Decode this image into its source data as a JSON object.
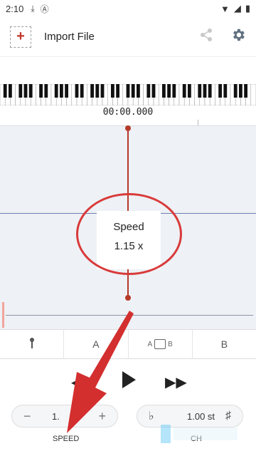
{
  "status_bar": {
    "time": "2:10",
    "icons": [
      "download-icon",
      "text-a-icon"
    ],
    "right_icons": [
      "wifi-icon",
      "signal-icon",
      "battery-icon"
    ]
  },
  "app_bar": {
    "add_symbol": "+",
    "title": "Import File",
    "share_icon": "share-icon",
    "settings_icon": "gear-icon"
  },
  "timeline": {
    "timecode": "00:00.000"
  },
  "speed_popup": {
    "label": "Speed",
    "value": "1.15 x"
  },
  "ab_bar": {
    "a_label": "A",
    "b_label": "B",
    "loop_a": "A",
    "loop_b": "B"
  },
  "controls": {
    "speed": {
      "value": "1.",
      "label": "SPEED",
      "minus": "−",
      "plus": "+"
    },
    "pitch": {
      "value": "1.00 st",
      "label": "CH",
      "flat": "♭",
      "sharp": "♯"
    }
  },
  "colors": {
    "accent": "#b53a2c",
    "annotation": "#d93a3a",
    "wave_bg": "#eef1f5"
  }
}
